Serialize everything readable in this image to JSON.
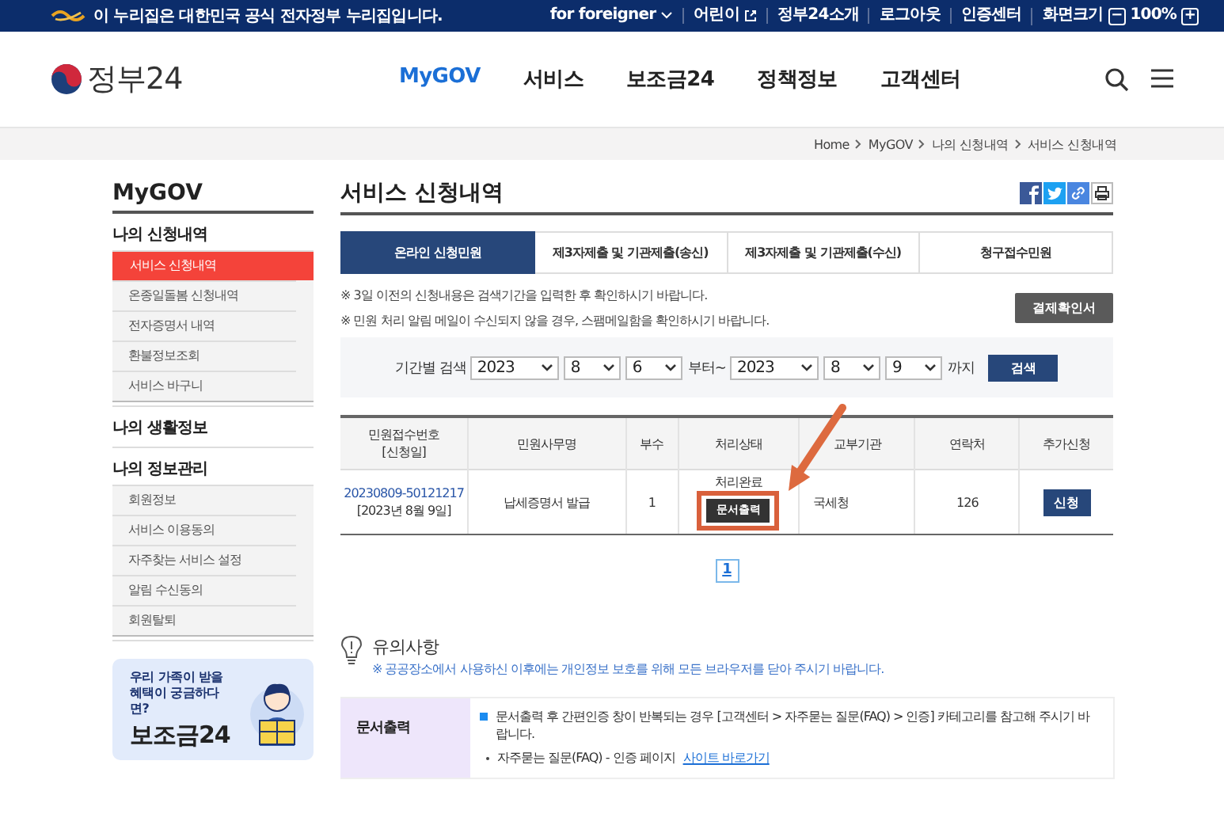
{
  "top_bar": {
    "notice": "이 누리집은 대한민국 공식 전자정부 누리집입니다.",
    "links": [
      {
        "label": "for foreigner",
        "kind": "dropdown"
      },
      {
        "label": "어린이",
        "kind": "external"
      },
      {
        "label": "정부24소개",
        "kind": "plain"
      },
      {
        "label": "로그아웃",
        "kind": "plain"
      },
      {
        "label": "인증센터",
        "kind": "plain"
      }
    ],
    "zoom": {
      "label": "화면크기",
      "minus": "−",
      "value": "100%",
      "plus": "+"
    }
  },
  "header": {
    "logo": "정부24",
    "nav": [
      {
        "label": "MyGOV",
        "selected": true
      },
      {
        "label": "서비스",
        "selected": false
      },
      {
        "label": "보조금24",
        "selected": false
      },
      {
        "label": "정책정보",
        "selected": false
      },
      {
        "label": "고객센터",
        "selected": false
      }
    ]
  },
  "breadcrumb": [
    "Home",
    "MyGOV",
    "나의 신청내역",
    "서비스 신청내역"
  ],
  "sidebar": {
    "title": "MyGOV",
    "groups": [
      {
        "label": "나의 신청내역",
        "items": [
          {
            "label": "서비스 신청내역",
            "selected": true
          },
          {
            "label": "온종일돌봄 신청내역",
            "selected": false
          },
          {
            "label": "전자증명서 내역",
            "selected": false
          },
          {
            "label": "환불정보조회",
            "selected": false
          },
          {
            "label": "서비스 바구니",
            "selected": false
          }
        ]
      },
      {
        "label": "나의 생활정보"
      },
      {
        "label": "나의 정보관리",
        "items": [
          {
            "label": "회원정보",
            "selected": false
          },
          {
            "label": "서비스 이용동의",
            "selected": false
          },
          {
            "label": "자주찾는 서비스 설정",
            "selected": false
          },
          {
            "label": "알림 수신동의",
            "selected": false
          },
          {
            "label": "회원탈퇴",
            "selected": false
          }
        ]
      }
    ],
    "banner": {
      "text": "우리 가족이 받을 혜택이 궁금하다면?",
      "title": "보조금24"
    }
  },
  "main": {
    "title": "서비스 신청내역",
    "tabs": [
      {
        "label": "온라인 신청민원",
        "selected": true
      },
      {
        "label": "제3자제출 및 기관제출(송신)",
        "selected": false
      },
      {
        "label": "제3자제출 및 기관제출(수신)",
        "selected": false
      },
      {
        "label": "청구접수민원",
        "selected": false
      }
    ],
    "notes": [
      "※ 3일 이전의 신청내용은 검색기간을 입력한 후 확인하시기 바랍니다.",
      "※ 민원 처리 알림 메일이 수신되지 않을 경우, 스팸메일함을 확인하시기 바랍니다."
    ],
    "receipt_button": "결제확인서",
    "search": {
      "label": "기간별 검색",
      "from": [
        "2023",
        "8",
        "6"
      ],
      "from_suffix": "부터~",
      "to": [
        "2023",
        "8",
        "9"
      ],
      "to_suffix": "까지",
      "button": "검색"
    },
    "table": {
      "columns": [
        "민원접수번호\n[신청일]",
        "민원사무명",
        "부수",
        "처리상태",
        "교부기관",
        "연락처",
        "추가신청"
      ],
      "rows": [
        {
          "receipt_no": "20230809-50121217",
          "date": "[2023년 8월 9일]",
          "service": "납세증명서 발급",
          "copies": "1",
          "status": "처리완료",
          "print_button": "문서출력",
          "agency": "국세청",
          "contact": "126",
          "action": "신청"
        }
      ]
    },
    "pagination": [
      {
        "label": "1",
        "selected": true
      }
    ],
    "notice": {
      "title": "유의사항",
      "text": "※ 공공장소에서 사용하신 이후에는 개인정보 보호를 위해 모든 브라우저를 닫아 주시기 바랍니다."
    },
    "info_rows": [
      {
        "heading": "문서출력",
        "bullet": "문서출력 후 간편인증 창이 반복되는 경우 [고객센터 > 자주묻는 질문(FAQ) > 인증] 카테고리를 참고해 주시기 바랍니다.",
        "sub": "자주묻는 질문(FAQ) - 인증 페이지",
        "link": "사이트 바로가기"
      }
    ]
  }
}
